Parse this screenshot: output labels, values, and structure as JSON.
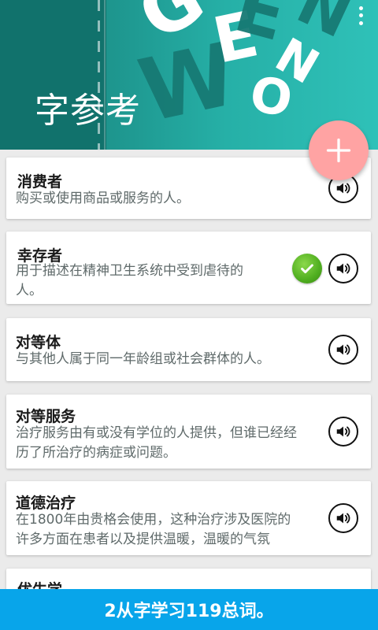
{
  "header": {
    "title": "字参考",
    "decorative_letters": [
      "G",
      "E",
      "W",
      "E",
      "N",
      "O",
      "N"
    ],
    "menu_icon": "overflow-menu-icon"
  },
  "fab": {
    "icon": "plus-icon",
    "color": "#ffa3a3"
  },
  "words": [
    {
      "word": "消费者",
      "definition_lines": [
        "购买或使用商品或服务的人。"
      ],
      "learned": false
    },
    {
      "word": "幸存者",
      "definition_lines": [
        "用于描述在精神卫生系统中受到虐待的",
        "人。"
      ],
      "learned": true
    },
    {
      "word": "对等体",
      "definition_lines": [
        "与其他人属于同一年龄组或社会群体的人。"
      ],
      "learned": false
    },
    {
      "word": "对等服务",
      "definition_lines": [
        "治疗服务由有或没有学位的人提供，但谁已经经",
        "历了所治疗的病症或问题。"
      ],
      "learned": false
    },
    {
      "word": "道德治疗",
      "definition_lines": [
        "在1800年由贵格会使用，这种治疗涉及医院的",
        "许多方面在患者以及提供温暖，温暖的气氛"
      ],
      "learned": false
    },
    {
      "word": "优生学",
      "definition_lines": [],
      "learned": false
    }
  ],
  "icons": {
    "speaker": "speaker-icon",
    "check": "check-icon"
  },
  "footer": {
    "text": "2从字学习119总词。",
    "color": "#08a5ea"
  }
}
